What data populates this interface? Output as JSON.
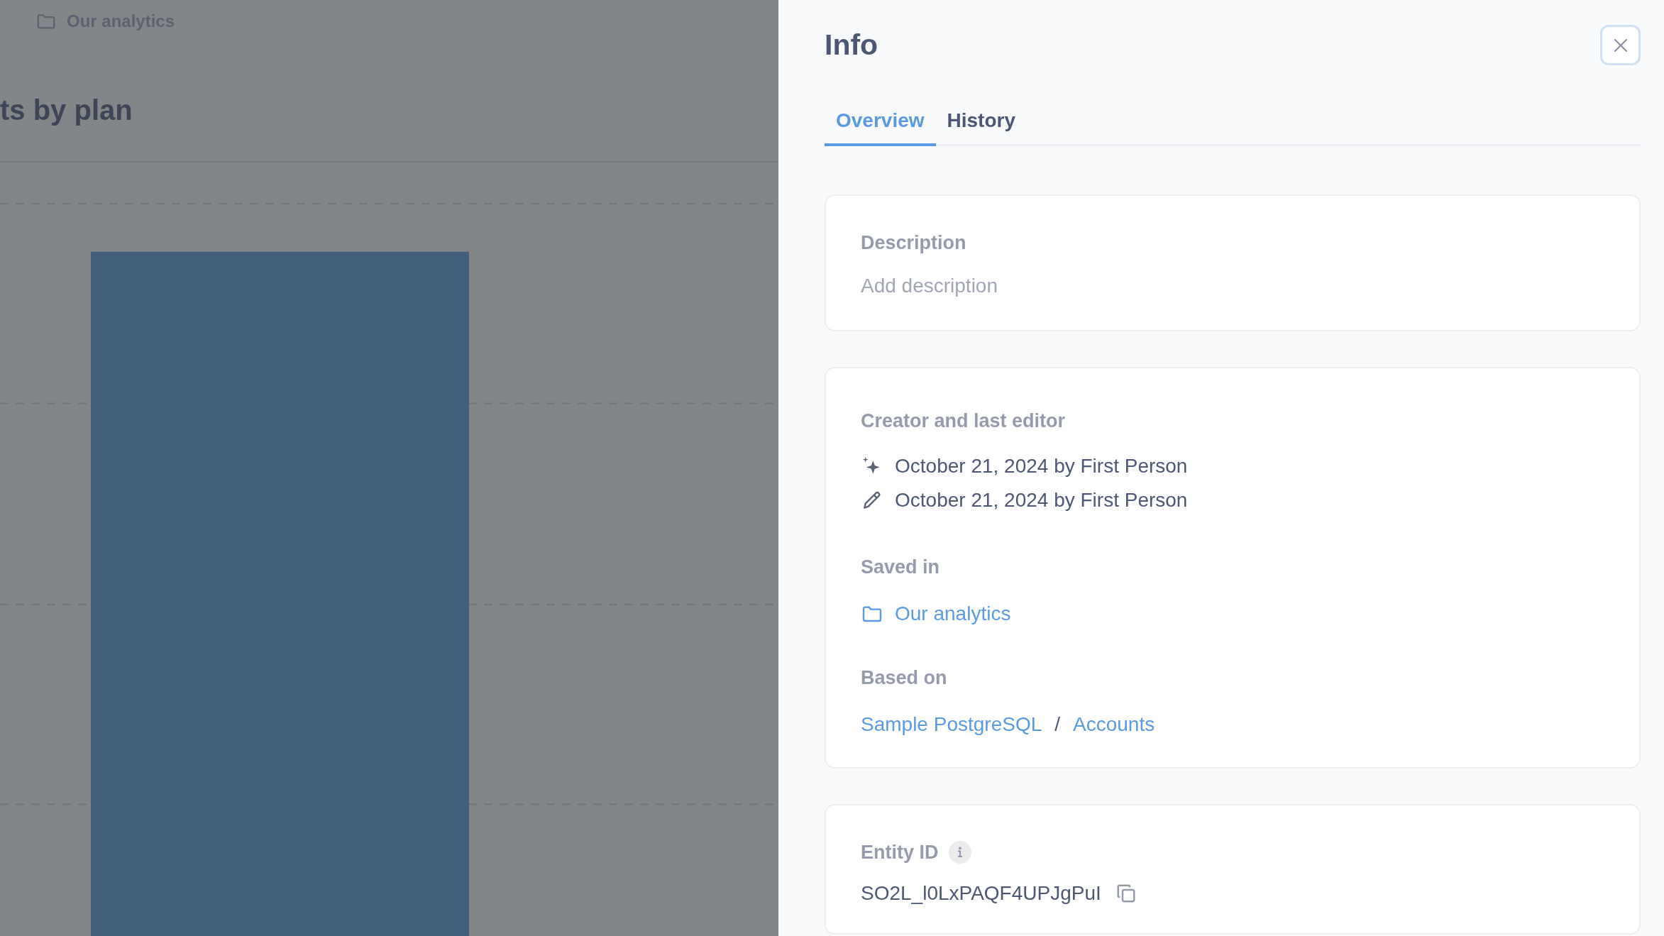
{
  "background": {
    "breadcrumb": "Our analytics",
    "title": "ts by plan"
  },
  "panel": {
    "title": "Info",
    "tabs": [
      {
        "label": "Overview",
        "selected": true
      },
      {
        "label": "History",
        "selected": false
      }
    ],
    "description": {
      "heading": "Description",
      "placeholder": "Add description"
    },
    "details": {
      "heading": "Creator and last editor",
      "events": [
        {
          "kind": "created",
          "text": "October 21, 2024 by First Person"
        },
        {
          "kind": "edited",
          "text": "October 21, 2024 by First Person"
        }
      ],
      "saved_in": {
        "heading": "Saved in",
        "collection": "Our analytics"
      },
      "based_on": {
        "heading": "Based on",
        "links": [
          "Sample PostgreSQL",
          "Accounts"
        ],
        "separator": "/"
      }
    },
    "entity_id": {
      "heading": "Entity ID",
      "value": "SO2L_l0LxPAQF4UPJgPuI"
    }
  }
}
